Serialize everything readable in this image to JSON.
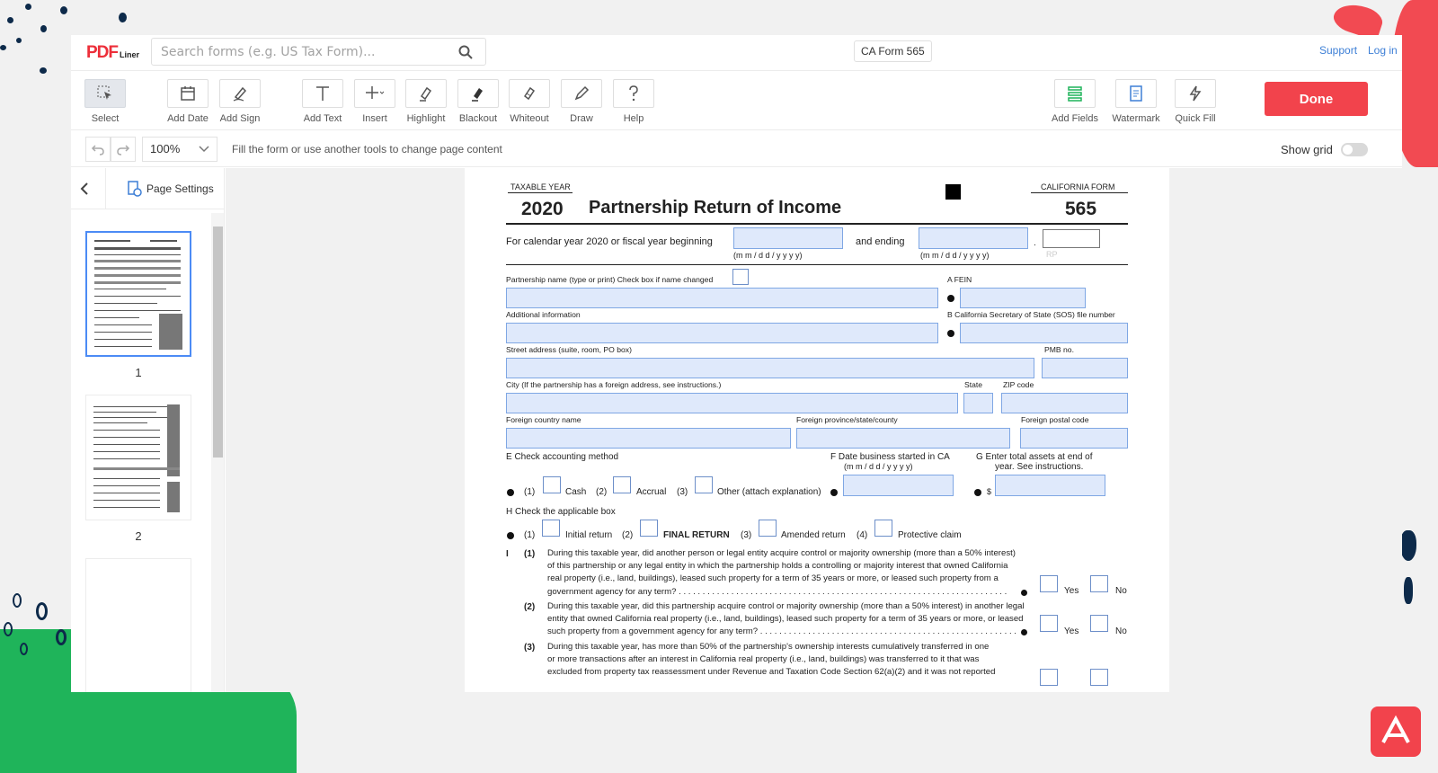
{
  "colors": {
    "brand_red": "#f2434c",
    "link_blue": "#3d7fd6",
    "field_blue": "#dfe9fb",
    "accent_green": "#1fb45a",
    "navy": "#0d2a4a"
  },
  "header": {
    "logo": "PDF",
    "logo_sub": "Liner",
    "search_placeholder": "Search forms (e.g. US Tax Form)...",
    "doc_name": "CA Form 565",
    "support": "Support",
    "login": "Log in"
  },
  "toolbar": {
    "tools": [
      {
        "label": "Select",
        "icon": "cursor-select-icon"
      },
      {
        "label": "Add Date",
        "icon": "calendar-icon"
      },
      {
        "label": "Add Sign",
        "icon": "signature-pen-icon"
      },
      {
        "label": "Add Text",
        "icon": "text-t-icon"
      },
      {
        "label": "Insert",
        "icon": "plus-dropdown-icon"
      },
      {
        "label": "Highlight",
        "icon": "highlighter-icon"
      },
      {
        "label": "Blackout",
        "icon": "blackout-marker-icon"
      },
      {
        "label": "Whiteout",
        "icon": "eraser-icon"
      },
      {
        "label": "Draw",
        "icon": "pencil-icon"
      },
      {
        "label": "Help",
        "icon": "question-icon"
      },
      {
        "label": "Add Fields",
        "icon": "fields-icon"
      },
      {
        "label": "Watermark",
        "icon": "watermark-doc-icon"
      },
      {
        "label": "Quick Fill",
        "icon": "lightning-icon"
      }
    ],
    "done": "Done"
  },
  "subbar": {
    "zoom": "100%",
    "hint": "Fill the form or use another tools to change page content",
    "show_grid": "Show grid"
  },
  "sidebar": {
    "page_settings": "Page Settings",
    "pages": [
      "1",
      "2"
    ]
  },
  "form": {
    "taxable_year_label": "TAXABLE YEAR",
    "year": "2020",
    "title": "Partnership Return of Income",
    "ca_form_label": "CALIFORNIA  FORM",
    "form_number": "565",
    "calendar_line": "For calendar year 2020 or fiscal year beginning",
    "and_ending": "and ending",
    "date_hint": "(m m / d  d / y   y   y   y)",
    "rp": "RP",
    "partnership_name": "Partnership name (type or print)  Check box if name changed",
    "fein": "A  FEIN",
    "additional_info": "Additional information",
    "sos": "B  California Secretary of State (SOS) file number",
    "street": "Street address (suite, room, PO box)",
    "pmb": "PMB no.",
    "city": "City (If the partnership has a foreign address, see instructions.)",
    "state": "State",
    "zip": "ZIP code",
    "foreign_country": "Foreign country name",
    "foreign_province": "Foreign province/state/county",
    "foreign_postal": "Foreign postal code",
    "e_label": "E  Check accounting method",
    "f_label": "F   Date business started in CA",
    "f_hint": "(m m / d  d / y   y   y   y)",
    "g_label": "G    Enter total assets at end of",
    "g_label2": "year. See instructions.",
    "e1": "(1)",
    "cash": "Cash",
    "e2": "(2)",
    "accrual": "Accrual",
    "e3": "(3)",
    "other": "Other (attach explanation)",
    "dollar": "$",
    "h_label": "H  Check the applicable box",
    "h1": "(1)",
    "initial": "Initial return",
    "h2": "(2)",
    "final": "FINAL RETURN",
    "h3": "(3)",
    "amended": "Amended return",
    "h4": "(4)",
    "protective": "Protective claim",
    "i_label": "I",
    "q1_num": "(1)",
    "q1": [
      "During this taxable year, did another person or legal entity acquire control or majority ownership (more than a 50% interest)",
      "of this partnership or any legal entity in which the partnership holds a controlling or majority interest that owned California",
      "real property (i.e., land, buildings), leased such property for a term of 35 years or more, or leased such property from a",
      "government agency for any term? . . . . . . . . . . . . . . . . . . . . . . . . . . . . . . . . . . . . . . . . . . . . . . . . . . . . . . . . . . . . . . . . . . . . ."
    ],
    "q2_num": "(2)",
    "q2": [
      "During this taxable year, did this partnership acquire control or majority ownership (more than a 50% interest) in another legal",
      "entity that owned California real property (i.e., land, buildings), leased such property for a term of 35 years or more, or leased",
      "such property from a government agency for any term? . . . . . . . . . . . . . . . . . . . . . . . . . . . . . . . . . . . . . . . . . . . . . . . . . . . . . ."
    ],
    "q3_num": "(3)",
    "q3": [
      "During this taxable year, has more than 50% of the partnership's ownership interests cumulatively transferred in one",
      "or more transactions after an interest in California real property (i.e., land, buildings) was transferred to it that was",
      "excluded from property tax reassessment under Revenue and Taxation Code Section 62(a)(2) and it was not reported"
    ],
    "yes": "Yes",
    "no": "No"
  }
}
